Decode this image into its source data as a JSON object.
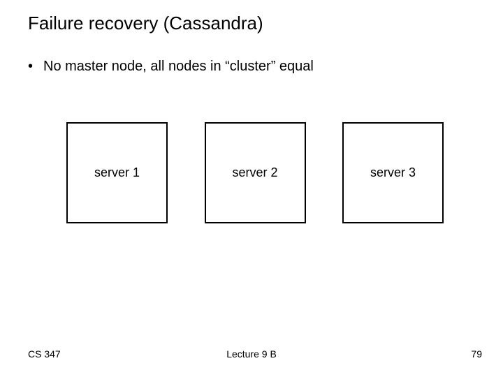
{
  "title": "Failure recovery (Cassandra)",
  "bullets": [
    {
      "text": "No master node, all nodes in “cluster” equal"
    }
  ],
  "diagram": {
    "servers": [
      {
        "label": "server 1"
      },
      {
        "label": "server 2"
      },
      {
        "label": "server 3"
      }
    ]
  },
  "footer": {
    "course": "CS 347",
    "lecture": "Lecture 9 B",
    "page": "79"
  }
}
